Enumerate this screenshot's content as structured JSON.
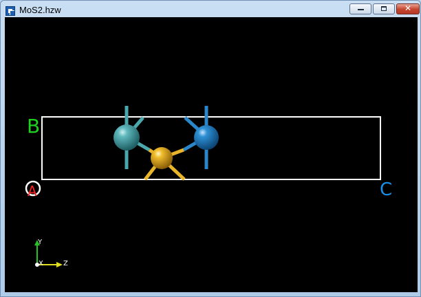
{
  "window": {
    "title": "MoS2.hzw",
    "controls": {
      "minimize_icon": "minimize-icon",
      "maximize_icon": "restore-icon",
      "close_icon": "close-icon",
      "close_glyph": "✕"
    }
  },
  "viewer": {
    "background": "#000000",
    "cell_labels": {
      "a": "A",
      "b": "B",
      "c": "C"
    },
    "cell_label_colors": {
      "a": "#ff2020",
      "b": "#1fd11f",
      "c": "#1a8fe8"
    },
    "cell_edge_color": "#ffffff",
    "atoms": [
      {
        "name": "atom-teal",
        "color": "#4aa8ad"
      },
      {
        "name": "atom-gold",
        "color": "#e8b52a"
      },
      {
        "name": "atom-blue",
        "color": "#2a86c8"
      }
    ],
    "axes_triad": {
      "y_label": "Y",
      "x_label": "X",
      "z_label": "Z",
      "y_color": "#22c322",
      "z_color": "#e0e020",
      "x_color": "#ffffff"
    }
  }
}
